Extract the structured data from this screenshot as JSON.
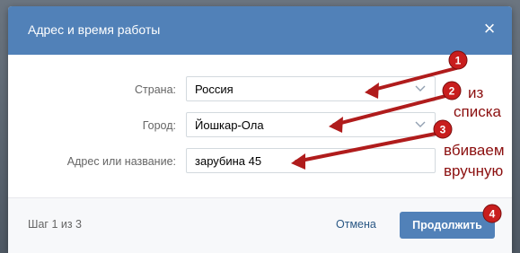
{
  "dialog": {
    "title": "Адрес и время работы",
    "close_icon": "close-icon"
  },
  "form": {
    "country": {
      "label": "Страна:",
      "value": "Россия"
    },
    "city": {
      "label": "Город:",
      "value": "Йошкар-Ола"
    },
    "address": {
      "label": "Адрес или название:",
      "value": "зарубина 45"
    }
  },
  "footer": {
    "step": "Шаг 1 из 3",
    "cancel": "Отмена",
    "continue": "Продолжить"
  },
  "annotations": {
    "markers": [
      "1",
      "2",
      "3",
      "4"
    ],
    "note_from_list_1": "из",
    "note_from_list_2": "списка",
    "note_manual_1": "вбиваем",
    "note_manual_2": "вручную",
    "color": "#b01c1c"
  }
}
